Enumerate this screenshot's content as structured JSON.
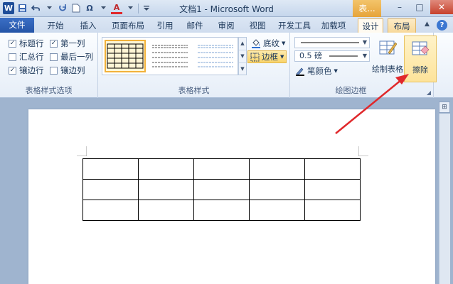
{
  "title_bar": {
    "title": "文档1 - Microsoft Word",
    "context_tab_title": "表...",
    "quick_access": [
      "word-logo",
      "save-icon",
      "undo-icon",
      "redo-icon",
      "new-doc-icon",
      "symbol-icon",
      "font-color-icon",
      "customize-icon"
    ],
    "symbol_label": "Ω",
    "font_color_label": "A",
    "word_logo_label": "W",
    "window_controls": {
      "minimize": "–",
      "maximize": "□",
      "close": "✕"
    }
  },
  "tabs": {
    "file": "文件",
    "items": [
      "开始",
      "插入",
      "页面布局",
      "引用",
      "邮件",
      "审阅",
      "视图",
      "开发工具",
      "加载项"
    ],
    "context_design": "设计",
    "context_layout": "布局",
    "help": "?"
  },
  "ribbon": {
    "table_style_options": {
      "label": "表格样式选项",
      "checkboxes": [
        {
          "label": "标题行",
          "checked": true
        },
        {
          "label": "第一列",
          "checked": true
        },
        {
          "label": "汇总行",
          "checked": false
        },
        {
          "label": "最后一列",
          "checked": false
        },
        {
          "label": "镶边行",
          "checked": true
        },
        {
          "label": "镶边列",
          "checked": false
        }
      ]
    },
    "table_styles": {
      "label": "表格样式",
      "shading": "底纹",
      "borders": "边框"
    },
    "draw_borders": {
      "label": "绘图边框",
      "line_weight": "0.5 磅",
      "pen_color": "笔颜色",
      "draw_table": "绘制表格",
      "eraser": "擦除"
    }
  },
  "colors": {
    "accent_blue": "#2555a7",
    "context_orange": "#e6a43a",
    "annotation_red": "#e0282b",
    "highlight_yellow": "#fde39a"
  }
}
